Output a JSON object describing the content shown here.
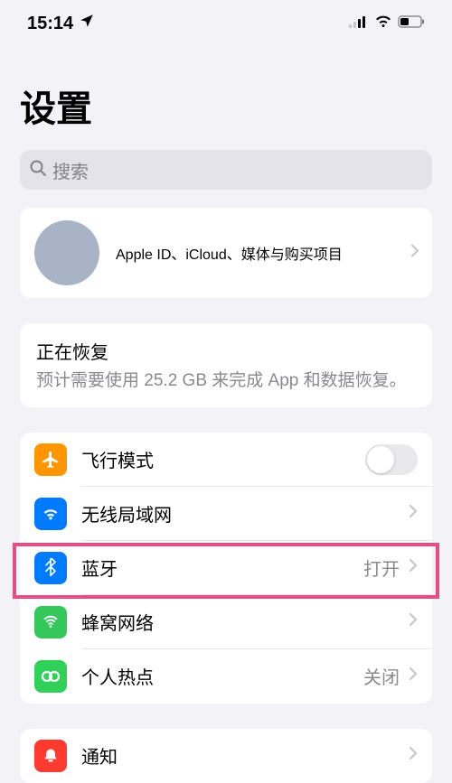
{
  "status": {
    "time": "15:14"
  },
  "title": "设置",
  "search": {
    "placeholder": "搜索"
  },
  "profile": {
    "subtitle": "Apple ID、iCloud、媒体与购买项目"
  },
  "restore": {
    "title": "正在恢复",
    "subtitle": "预计需要使用 25.2 GB 来完成 App 和数据恢复。"
  },
  "rows": {
    "airplane": "飞行模式",
    "wifi": "无线局域网",
    "bluetooth": "蓝牙",
    "bluetooth_value": "打开",
    "cellular": "蜂窝网络",
    "hotspot": "个人热点",
    "hotspot_value": "关闭",
    "notifications": "通知"
  }
}
